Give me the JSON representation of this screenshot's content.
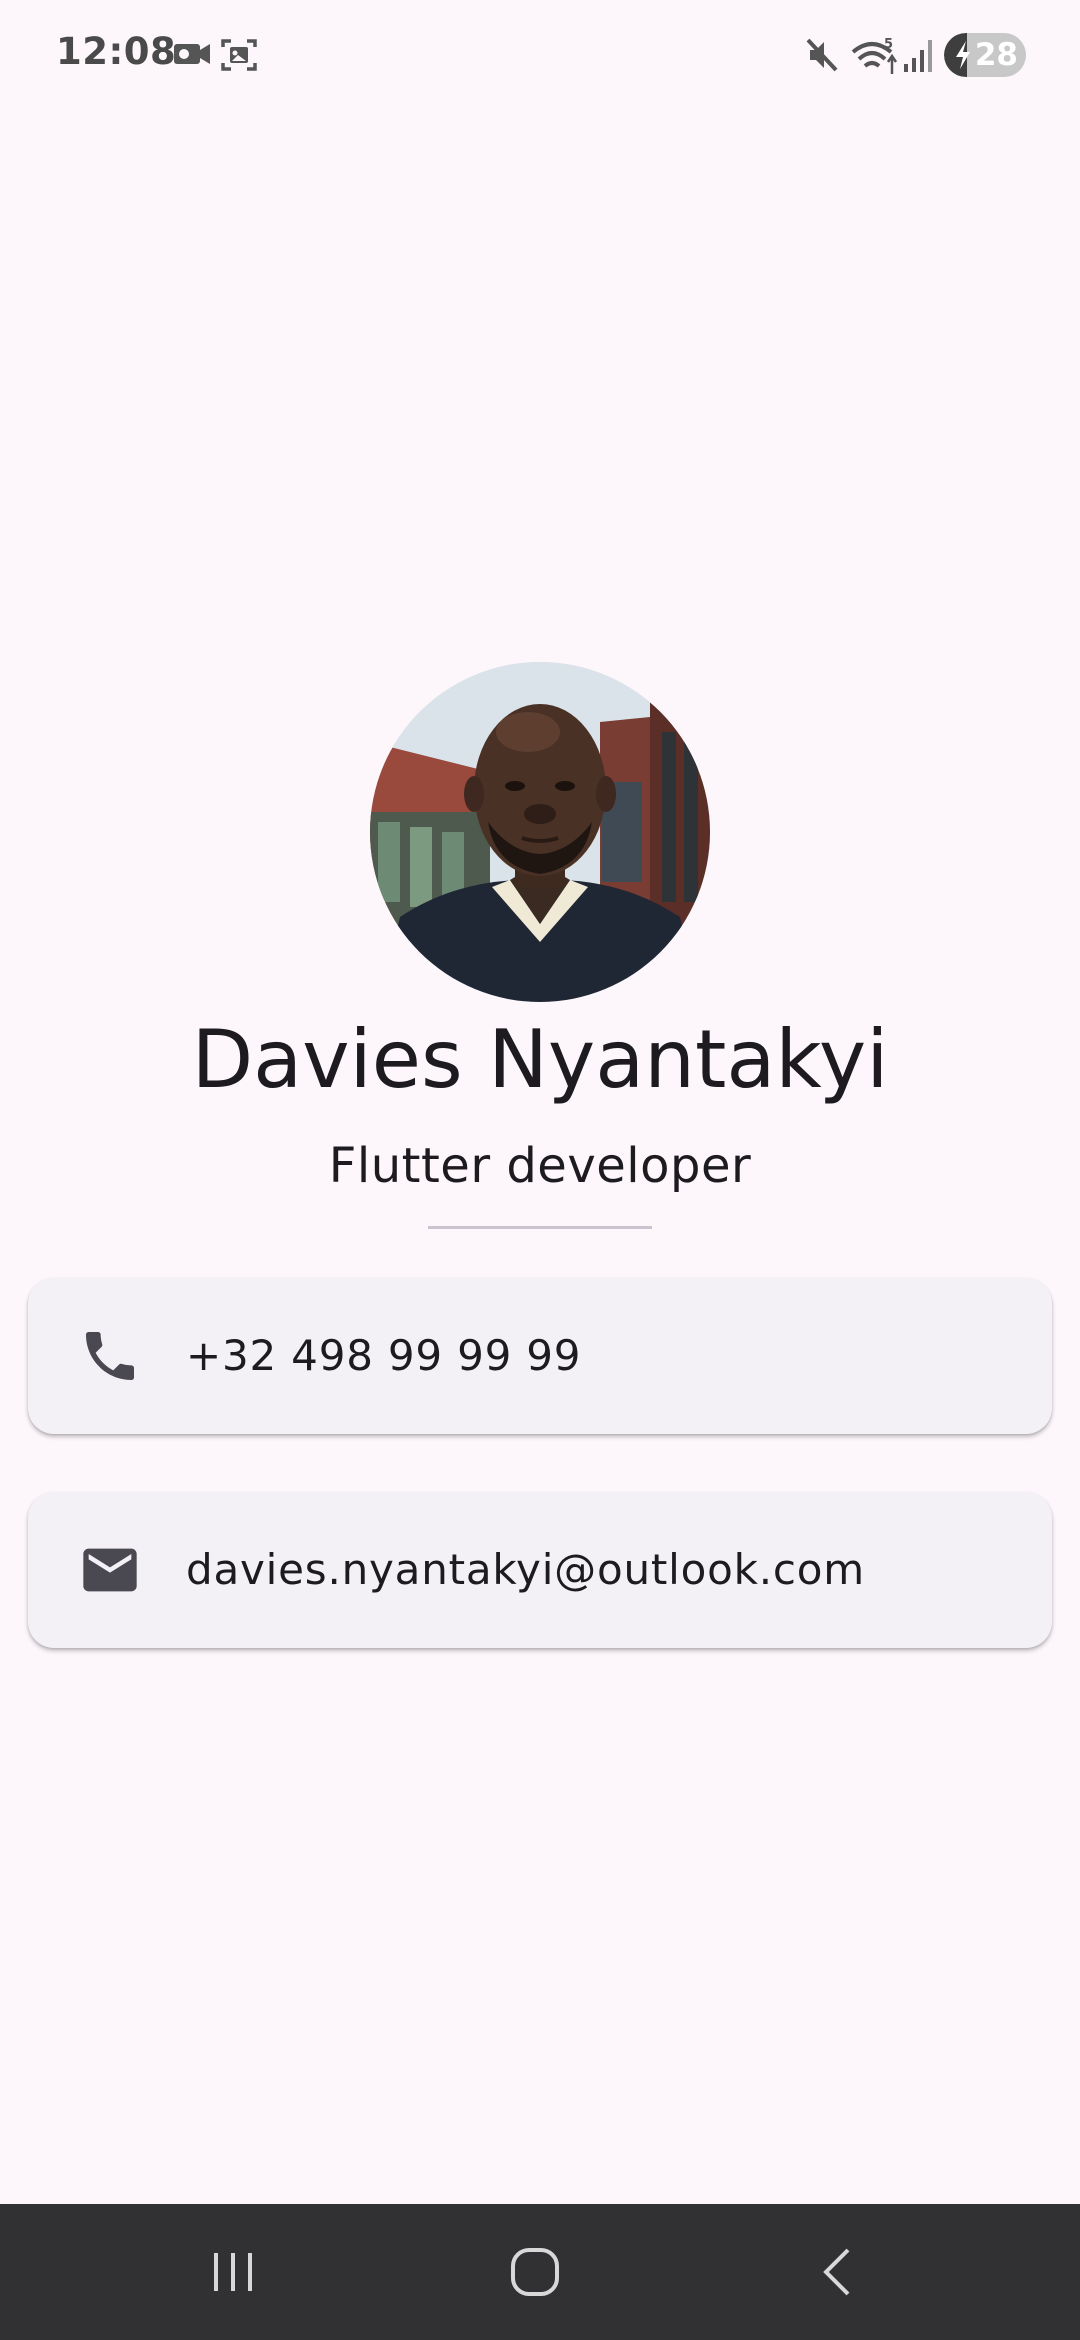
{
  "status_bar": {
    "time": "12:08",
    "battery_level": "28",
    "battery_fraction": 0.28,
    "icons": [
      "video-call-icon",
      "screenshot-icon",
      "mute-icon",
      "wifi-icon",
      "signal-icon",
      "charging-icon"
    ]
  },
  "profile": {
    "name": "Davies Nyantakyi",
    "title": "Flutter developer",
    "avatar": "profile-photo"
  },
  "contacts": [
    {
      "icon": "phone-icon",
      "text": "+32 498 99 99 99"
    },
    {
      "icon": "mail-icon",
      "text": "davies.nyantakyi@outlook.com"
    }
  ],
  "nav_bar": {
    "buttons": [
      "recent-apps-icon",
      "home-icon",
      "back-icon"
    ]
  },
  "colors": {
    "background": "#fdf7fb",
    "card": "#f3f0f6",
    "text": "#1d1b20",
    "divider": "#cac4d0",
    "nav_bar": "#313033"
  }
}
